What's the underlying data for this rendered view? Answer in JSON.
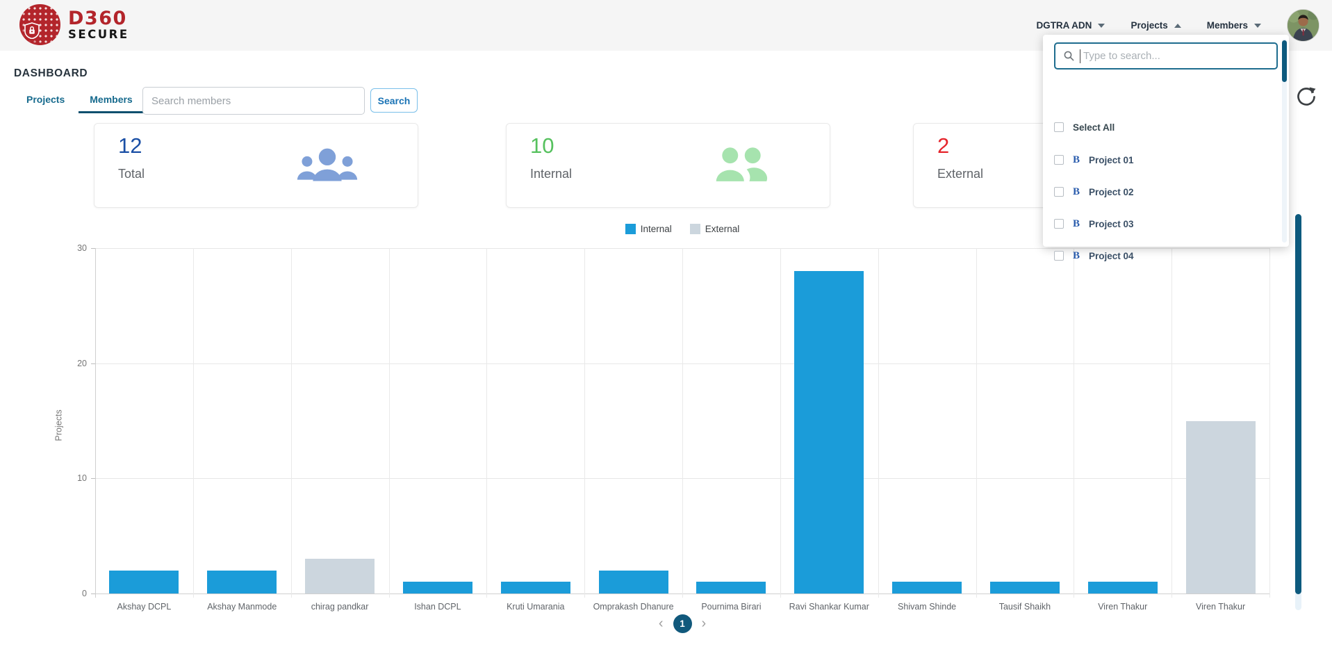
{
  "header": {
    "logo_line1": "D360",
    "logo_line2": "SECURE",
    "nav": [
      {
        "label": "DGTRA ADN",
        "caret": "down"
      },
      {
        "label": "Projects",
        "caret": "up"
      },
      {
        "label": "Members",
        "caret": "down"
      }
    ]
  },
  "page": {
    "title": "DASHBOARD"
  },
  "tabs": [
    {
      "label": "Projects",
      "active": false
    },
    {
      "label": "Members",
      "active": true
    }
  ],
  "member_search": {
    "placeholder": "Search members",
    "button_label": "Search"
  },
  "cards": [
    {
      "value": "12",
      "label": "Total",
      "value_color": "#1a4fa5",
      "icon": "group-people-icon",
      "icon_color": "#7fa0d8"
    },
    {
      "value": "10",
      "label": "Internal",
      "value_color": "#56c15e",
      "icon": "two-people-icon",
      "icon_color": "#a6e3ae"
    },
    {
      "value": "2",
      "label": "External",
      "value_color": "#e5252c",
      "icon": "two-people-icon",
      "icon_color": "#f2a6aa"
    }
  ],
  "project_dropdown": {
    "search_placeholder": "Type to search...",
    "select_all_label": "Select All",
    "items": [
      {
        "label": "Project 01"
      },
      {
        "label": "Project 02"
      },
      {
        "label": "Project 03"
      },
      {
        "label": "Project 04"
      }
    ]
  },
  "chart_data": {
    "type": "bar",
    "title": "",
    "xlabel": "",
    "ylabel": "Projects",
    "ylim": [
      0,
      30
    ],
    "yticks": [
      0,
      10,
      20,
      30
    ],
    "grid": true,
    "legend_position": "top-center",
    "categories": [
      "Akshay DCPL",
      "Akshay Manmode",
      "chirag pandkar",
      "Ishan DCPL",
      "Kruti Umarania",
      "Omprakash Dhanure",
      "Pournima Birari",
      "Ravi Shankar Kumar",
      "Shivam Shinde",
      "Tausif Shaikh",
      "Viren Thakur",
      "Viren Thakur"
    ],
    "series": [
      {
        "name": "Internal",
        "color": "#1b9cd9",
        "values": [
          2,
          2,
          0,
          1,
          1,
          2,
          1,
          28,
          1,
          1,
          1,
          0
        ]
      },
      {
        "name": "External",
        "color": "#ccd6de",
        "values": [
          0,
          0,
          3,
          0,
          0,
          0,
          0,
          0,
          0,
          0,
          0,
          15
        ]
      }
    ]
  },
  "pagination": {
    "prev": "‹",
    "page": "1",
    "next": "›"
  },
  "colors": {
    "topbar_bg": "#f5f5f5",
    "brand_red": "#b3252b",
    "tab_active_underline": "#0c4f6e",
    "accent_dark_teal": "#0d5a7e",
    "bar_internal": "#1b9cd9",
    "bar_external": "#ccd6de"
  }
}
